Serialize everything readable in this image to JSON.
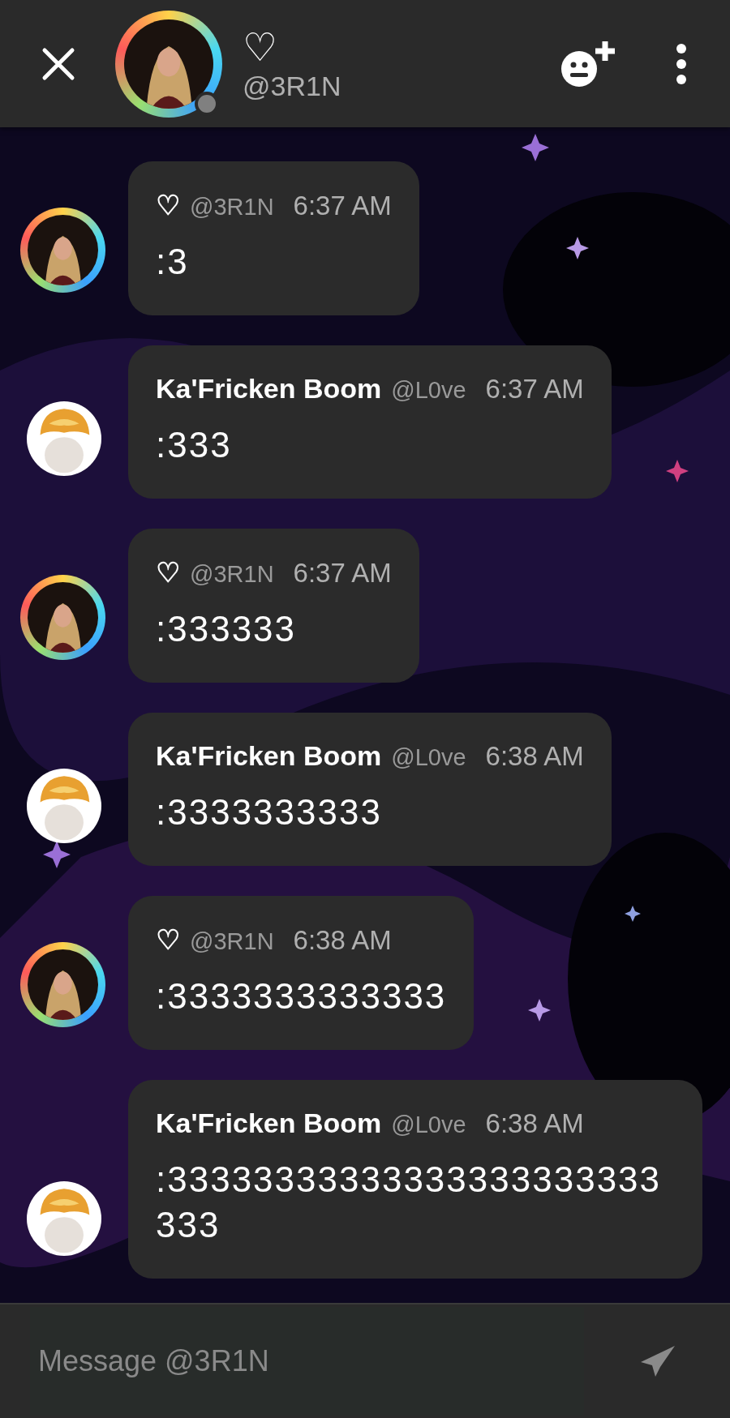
{
  "header": {
    "display_name": "♡",
    "username": "@3R1N"
  },
  "messages": [
    {
      "kind": "ring",
      "name": "♡",
      "handle": "@3R1N",
      "time": "6:37 AM",
      "text": ":3"
    },
    {
      "kind": "plain",
      "name": "Ka'Fricken Boom",
      "handle": "@L0ve",
      "time": "6:37 AM",
      "text": ":333"
    },
    {
      "kind": "ring",
      "name": "♡",
      "handle": "@3R1N",
      "time": "6:37 AM",
      "text": ":333333"
    },
    {
      "kind": "plain",
      "name": "Ka'Fricken Boom",
      "handle": "@L0ve",
      "time": "6:38 AM",
      "text": ":3333333333"
    },
    {
      "kind": "ring",
      "name": "♡",
      "handle": "@3R1N",
      "time": "6:38 AM",
      "text": ":3333333333333"
    },
    {
      "kind": "plain",
      "name": "Ka'Fricken Boom",
      "handle": "@L0ve",
      "time": "6:38 AM",
      "text": ":33333333333333333333333333"
    }
  ],
  "composer": {
    "placeholder": "Message @3R1N"
  }
}
